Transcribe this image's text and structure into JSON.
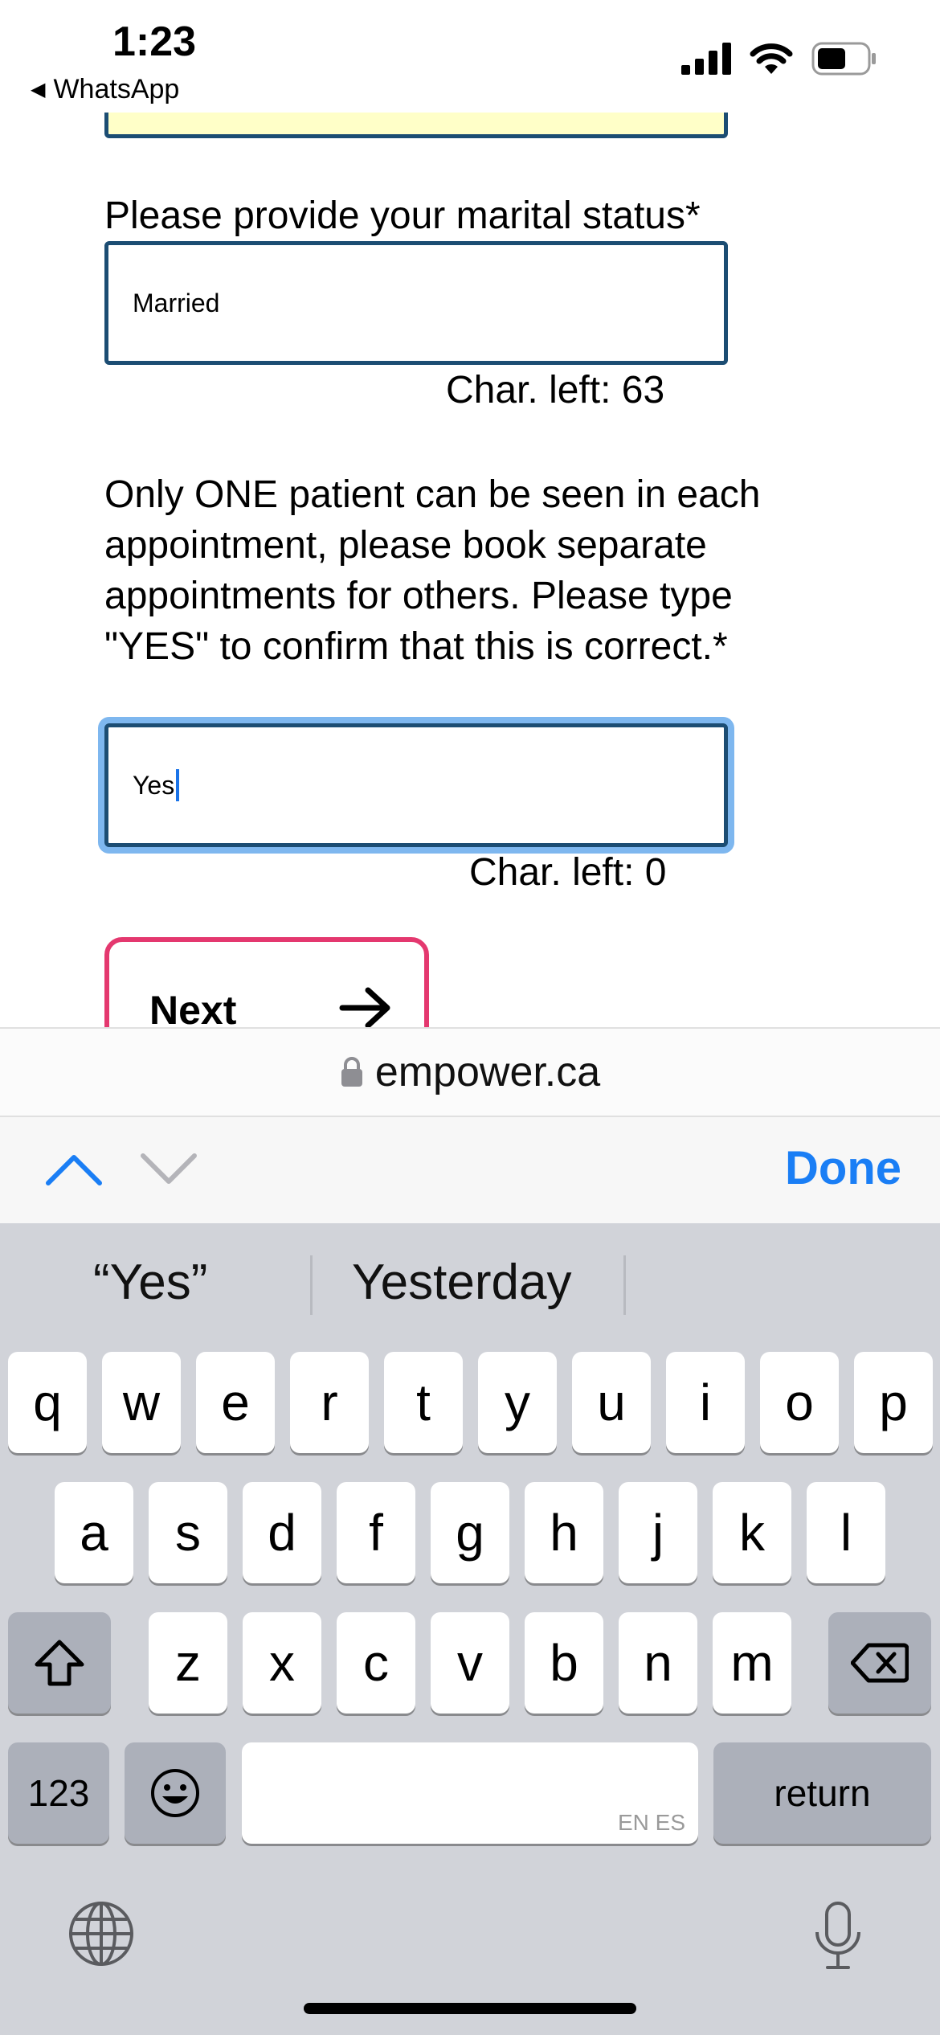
{
  "status_bar": {
    "time": "1:23",
    "back_app": "WhatsApp"
  },
  "form": {
    "marital_label": "Please provide your marital status*",
    "marital_value": "Married",
    "marital_chars_left": "Char. left: 63",
    "confirm_label": "Only ONE patient can be seen in each appointment, please book separate appointments for others. Please type \"YES\" to confirm that this is correct.*",
    "confirm_value": "Yes",
    "confirm_chars_left": "Char. left: 0",
    "next_label": "Next"
  },
  "url_bar": {
    "domain": "empower.ca"
  },
  "accessory_bar": {
    "done_label": "Done"
  },
  "keyboard": {
    "suggestions": [
      "“Yes”",
      "Yesterday"
    ],
    "row1": [
      "q",
      "w",
      "e",
      "r",
      "t",
      "y",
      "u",
      "i",
      "o",
      "p"
    ],
    "row2": [
      "a",
      "s",
      "d",
      "f",
      "g",
      "h",
      "j",
      "k",
      "l"
    ],
    "row3": [
      "z",
      "x",
      "c",
      "v",
      "b",
      "n",
      "m"
    ],
    "numbers_label": "123",
    "return_label": "return",
    "space_hint": "EN ES"
  },
  "colors": {
    "field_border": "#1c4d73",
    "focus_ring": "#7eb7ef",
    "next_border": "#e4386f",
    "done": "#1a7ef5"
  }
}
